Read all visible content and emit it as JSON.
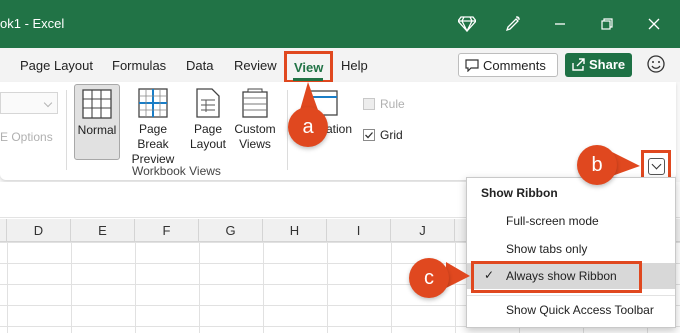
{
  "titlebar": {
    "title": "ok1  -  Excel",
    "icons": [
      "diamond-icon",
      "feedback-icon",
      "minimize-icon",
      "restore-icon",
      "close-icon"
    ]
  },
  "tabs": [
    "Page Layout",
    "Formulas",
    "Data",
    "Review",
    "View",
    "Help"
  ],
  "actions": {
    "comments": "Comments",
    "share": "Share",
    "emoji": "smiley-icon"
  },
  "ribbon": {
    "ghost_options": "E Options",
    "workbook_views": {
      "normal": "Normal",
      "page_break_1": "Page Break",
      "page_break_2": "Preview",
      "page_layout_1": "Page",
      "page_layout_2": "Layout",
      "custom_1": "Custom",
      "custom_2": "Views",
      "group_label": "Workbook Views"
    },
    "show_partial": "ation",
    "ruler": "Rule",
    "gridlines": "Grid"
  },
  "columns": [
    "D",
    "E",
    "F",
    "G",
    "H",
    "I",
    "J"
  ],
  "menu": {
    "title": "Show Ribbon",
    "items": [
      "Full-screen mode",
      "Show tabs only",
      "Always show Ribbon",
      "Show Quick Access Toolbar"
    ],
    "checked": "Always show Ribbon"
  },
  "callouts": {
    "a": "a",
    "b": "b",
    "c": "c"
  },
  "colors": {
    "excel_green": "#217346",
    "callout": "#e0481f"
  }
}
